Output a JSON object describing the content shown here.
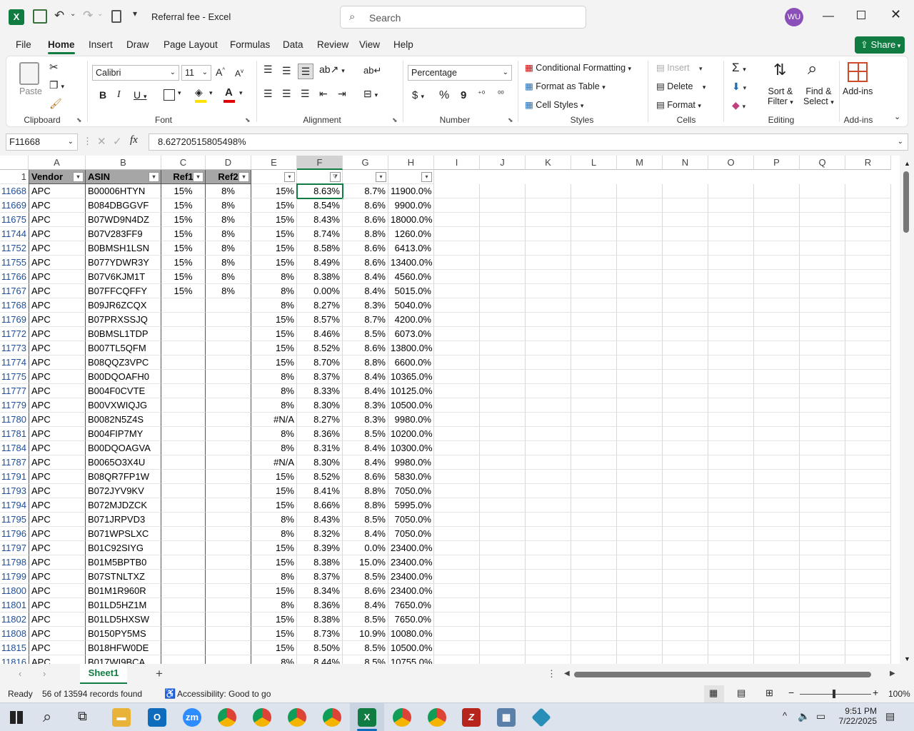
{
  "window": {
    "title": "Referral fee  -  Excel",
    "search_placeholder": "Search",
    "user_initials": "WU"
  },
  "tabs": [
    "File",
    "Home",
    "Insert",
    "Draw",
    "Page Layout",
    "Formulas",
    "Data",
    "Review",
    "View",
    "Help"
  ],
  "share_label": "Share",
  "ribbon": {
    "clipboard": {
      "paste": "Paste",
      "group": "Clipboard"
    },
    "font": {
      "name": "Calibri",
      "size": "11",
      "group": "Font"
    },
    "alignment": {
      "group": "Alignment"
    },
    "number": {
      "format": "Percentage",
      "group": "Number",
      "currency": "$",
      "percent": "%",
      "comma": "9"
    },
    "styles": {
      "cond": "Conditional Formatting",
      "table": "Format as Table",
      "cell": "Cell Styles",
      "group": "Styles"
    },
    "cells": {
      "insert": "Insert",
      "delete": "Delete",
      "format": "Format",
      "group": "Cells"
    },
    "editing": {
      "sort1": "Sort &",
      "sort2": "Filter",
      "find1": "Find &",
      "find2": "Select",
      "group": "Editing"
    },
    "addins": {
      "label": "Add-ins",
      "group": "Add-ins"
    }
  },
  "formula_bar": {
    "name_box": "F11668",
    "formula": "8.62720515805498%",
    "fx": "fx"
  },
  "columns": [
    "A",
    "B",
    "C",
    "D",
    "E",
    "F",
    "G",
    "H",
    "I",
    "J",
    "K",
    "L",
    "M",
    "N",
    "O",
    "P",
    "Q",
    "R"
  ],
  "header_row": {
    "num": "1",
    "cells": [
      "Vendor",
      "ASIN",
      "Ref1",
      "Ref2",
      "",
      "",
      "",
      ""
    ]
  },
  "rows": [
    [
      "11668",
      "APC",
      "B00006HTYN",
      "15%",
      "8%",
      "15%",
      "8.63%",
      "8.7%",
      "11900.0%"
    ],
    [
      "11669",
      "APC",
      "B084DBGGVF",
      "15%",
      "8%",
      "15%",
      "8.54%",
      "8.6%",
      "9900.0%"
    ],
    [
      "11675",
      "APC",
      "B07WD9N4DZ",
      "15%",
      "8%",
      "15%",
      "8.43%",
      "8.6%",
      "18000.0%"
    ],
    [
      "11744",
      "APC",
      "B07V283FF9",
      "15%",
      "8%",
      "15%",
      "8.74%",
      "8.8%",
      "1260.0%"
    ],
    [
      "11752",
      "APC",
      "B0BMSH1LSN",
      "15%",
      "8%",
      "15%",
      "8.58%",
      "8.6%",
      "6413.0%"
    ],
    [
      "11755",
      "APC",
      "B077YDWR3Y",
      "15%",
      "8%",
      "15%",
      "8.49%",
      "8.6%",
      "13400.0%"
    ],
    [
      "11766",
      "APC",
      "B07V6KJM1T",
      "15%",
      "8%",
      "8%",
      "8.38%",
      "8.4%",
      "4560.0%"
    ],
    [
      "11767",
      "APC",
      "B07FFCQFFY",
      "15%",
      "8%",
      "8%",
      "0.00%",
      "8.4%",
      "5015.0%"
    ],
    [
      "11768",
      "APC",
      "B09JR6ZCQX",
      "",
      "",
      "8%",
      "8.27%",
      "8.3%",
      "5040.0%"
    ],
    [
      "11769",
      "APC",
      "B07PRXSSJQ",
      "",
      "",
      "15%",
      "8.57%",
      "8.7%",
      "4200.0%"
    ],
    [
      "11772",
      "APC",
      "B0BMSL1TDP",
      "",
      "",
      "15%",
      "8.46%",
      "8.5%",
      "6073.0%"
    ],
    [
      "11773",
      "APC",
      "B007TL5QFM",
      "",
      "",
      "15%",
      "8.52%",
      "8.6%",
      "13800.0%"
    ],
    [
      "11774",
      "APC",
      "B08QQZ3VPC",
      "",
      "",
      "15%",
      "8.70%",
      "8.8%",
      "6600.0%"
    ],
    [
      "11775",
      "APC",
      "B00DQOAFH0",
      "",
      "",
      "8%",
      "8.37%",
      "8.4%",
      "10365.0%"
    ],
    [
      "11777",
      "APC",
      "B004F0CVTE",
      "",
      "",
      "8%",
      "8.33%",
      "8.4%",
      "10125.0%"
    ],
    [
      "11779",
      "APC",
      "B00VXWIQJG",
      "",
      "",
      "8%",
      "8.30%",
      "8.3%",
      "10500.0%"
    ],
    [
      "11780",
      "APC",
      "B0082N5Z4S",
      "",
      "",
      "#N/A",
      "8.27%",
      "8.3%",
      "9980.0%"
    ],
    [
      "11781",
      "APC",
      "B004FIP7MY",
      "",
      "",
      "8%",
      "8.36%",
      "8.5%",
      "10200.0%"
    ],
    [
      "11784",
      "APC",
      "B00DQOAGVA",
      "",
      "",
      "8%",
      "8.31%",
      "8.4%",
      "10300.0%"
    ],
    [
      "11787",
      "APC",
      "B0065O3X4U",
      "",
      "",
      "#N/A",
      "8.30%",
      "8.4%",
      "9980.0%"
    ],
    [
      "11791",
      "APC",
      "B08QR7FP1W",
      "",
      "",
      "15%",
      "8.52%",
      "8.6%",
      "5830.0%"
    ],
    [
      "11793",
      "APC",
      "B072JYV9KV",
      "",
      "",
      "15%",
      "8.41%",
      "8.8%",
      "7050.0%"
    ],
    [
      "11794",
      "APC",
      "B072MJDZCK",
      "",
      "",
      "15%",
      "8.66%",
      "8.8%",
      "5995.0%"
    ],
    [
      "11795",
      "APC",
      "B071JRPVD3",
      "",
      "",
      "8%",
      "8.43%",
      "8.5%",
      "7050.0%"
    ],
    [
      "11796",
      "APC",
      "B071WPSLXC",
      "",
      "",
      "8%",
      "8.32%",
      "8.4%",
      "7050.0%"
    ],
    [
      "11797",
      "APC",
      "B01C92SIYG",
      "",
      "",
      "15%",
      "8.39%",
      "0.0%",
      "23400.0%"
    ],
    [
      "11798",
      "APC",
      "B01M5BPTB0",
      "",
      "",
      "15%",
      "8.38%",
      "15.0%",
      "23400.0%"
    ],
    [
      "11799",
      "APC",
      "B07STNLTXZ",
      "",
      "",
      "8%",
      "8.37%",
      "8.5%",
      "23400.0%"
    ],
    [
      "11800",
      "APC",
      "B01M1R960R",
      "",
      "",
      "15%",
      "8.34%",
      "8.6%",
      "23400.0%"
    ],
    [
      "11801",
      "APC",
      "B01LD5HZ1M",
      "",
      "",
      "8%",
      "8.36%",
      "8.4%",
      "7650.0%"
    ],
    [
      "11802",
      "APC",
      "B01LD5HXSW",
      "",
      "",
      "15%",
      "8.38%",
      "8.5%",
      "7650.0%"
    ],
    [
      "11808",
      "APC",
      "B0150PY5MS",
      "",
      "",
      "15%",
      "8.73%",
      "10.9%",
      "10080.0%"
    ],
    [
      "11815",
      "APC",
      "B018HFW0DE",
      "",
      "",
      "15%",
      "8.50%",
      "8.5%",
      "10500.0%"
    ],
    [
      "11816",
      "APC",
      "B017WI9BCA",
      "",
      "",
      "8%",
      "8.44%",
      "8.5%",
      "10755.0%"
    ]
  ],
  "sheet_tab": "Sheet1",
  "status": {
    "ready": "Ready",
    "records": "56 of 13594 records found",
    "accessibility": "Accessibility: Good to go",
    "zoom": "100%"
  },
  "clock": {
    "time": "9:51 PM",
    "date": "7/22/2025"
  }
}
